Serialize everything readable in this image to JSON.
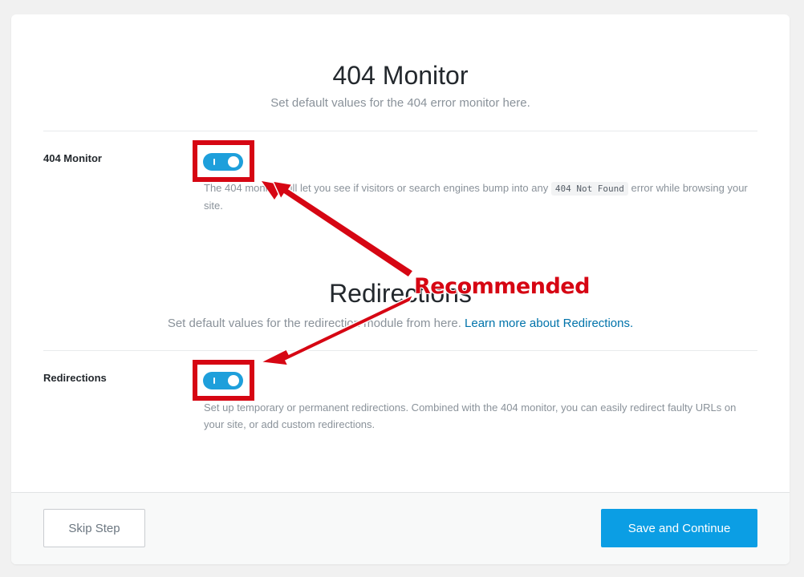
{
  "sections": {
    "monitor": {
      "title": "404 Monitor",
      "description": "Set default values for the 404 error monitor here.",
      "field_label": "404 Monitor",
      "toggle_on": true,
      "desc_part1": "The 404 monitor will let you see if visitors or search engines bump into any ",
      "desc_code": "404 Not Found",
      "desc_part2": " error while browsing your site."
    },
    "redirections": {
      "title": "Redirections",
      "description": "Set default values for the redirection module from here. ",
      "learn_more_link": "Learn more about Redirections.",
      "field_label": "Redirections",
      "toggle_on": true,
      "desc": "Set up temporary or permanent redirections. Combined with the 404 monitor, you can easily redirect faulty URLs on your site, or add custom redirections."
    }
  },
  "footer": {
    "skip_label": "Skip Step",
    "save_label": "Save and Continue"
  },
  "annotation": {
    "label": "Recommended",
    "color": "#d60613"
  },
  "colors": {
    "accent": "#0b9ee4",
    "toggle": "#1e9fdb",
    "link": "#0073aa"
  }
}
